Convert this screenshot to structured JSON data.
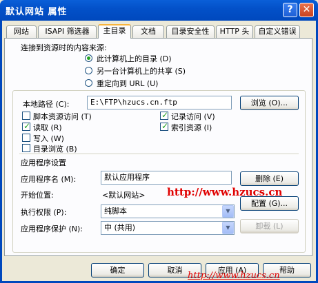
{
  "window": {
    "title": "默认网站 属性",
    "help": "?",
    "close": "✕"
  },
  "tabs": [
    "网站",
    "ISAPI 筛选器",
    "主目录",
    "文档",
    "目录安全性",
    "HTTP 头",
    "自定义错误"
  ],
  "content_source": {
    "label": "连接到资源时的内容来源:",
    "options": [
      "此计算机上的目录 (D)",
      "另一台计算机上的共享 (S)",
      "重定向到 URL (U)"
    ],
    "selected_index": 0
  },
  "local_path": {
    "label": "本地路径 (C):",
    "value": "E:\\FTP\\hzucs.cn.ftp",
    "browse_button": "浏览 (O)..."
  },
  "permissions": [
    {
      "label": "脚本资源访问 (T)",
      "checked": false
    },
    {
      "label": "读取 (R)",
      "checked": true
    },
    {
      "label": "写入 (W)",
      "checked": false
    },
    {
      "label": "目录浏览 (B)",
      "checked": false
    },
    {
      "label": "记录访问 (V)",
      "checked": true
    },
    {
      "label": "索引资源 (I)",
      "checked": true
    }
  ],
  "app_settings": {
    "heading": "应用程序设置",
    "name_label": "应用程序名 (M):",
    "name_value": "默认应用程序",
    "remove_button": "删除 (E)",
    "start_label": "开始位置:",
    "start_value": "<默认网站>",
    "config_button": "配置 (G)...",
    "exec_label": "执行权限 (P):",
    "exec_value": "纯脚本",
    "protect_label": "应用程序保护 (N):",
    "protect_value": "中 (共用)",
    "unload_button": "卸载 (L)"
  },
  "watermark": {
    "main": "http://www.hzucs.cn",
    "bottom": "http://www.hzucs.cn"
  },
  "footer": {
    "ok": "确定",
    "cancel": "取消",
    "apply": "应用 (A)",
    "help": "帮助"
  }
}
